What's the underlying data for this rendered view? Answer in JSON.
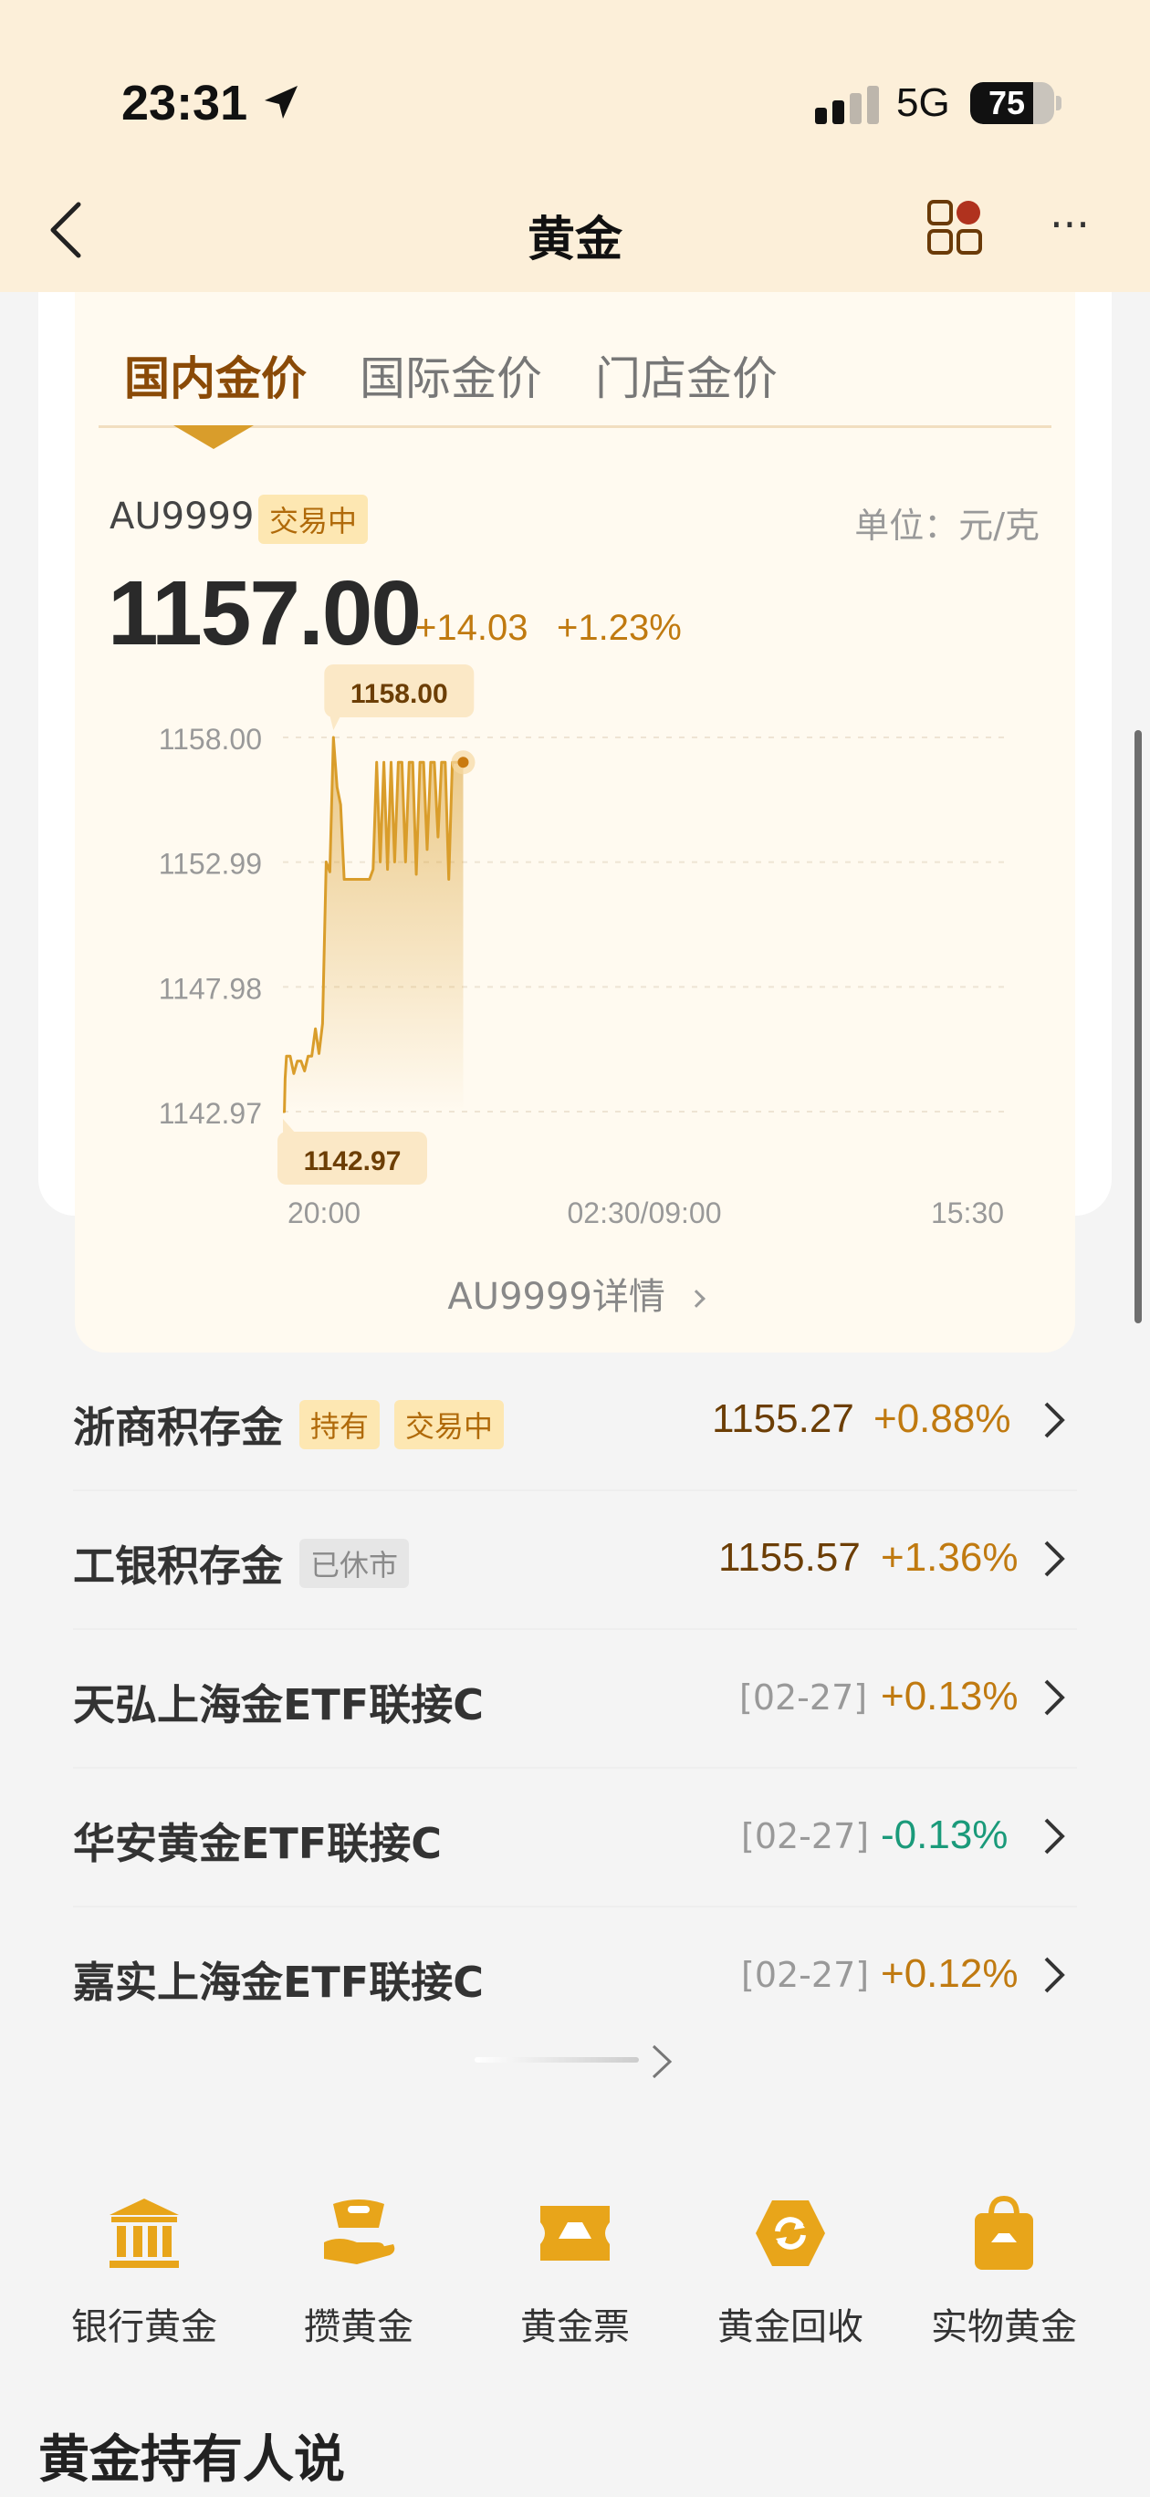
{
  "status_bar": {
    "time": "23:31",
    "network": "5G",
    "battery": "75"
  },
  "nav": {
    "title": "黄金"
  },
  "tabs": [
    {
      "label": "国内金价"
    },
    {
      "label": "国际金价"
    },
    {
      "label": "门店金价"
    }
  ],
  "quote": {
    "symbol": "AU9999",
    "status": "交易中",
    "unit": "单位：元/克",
    "price": "1157.00",
    "change": "+14.03",
    "change_pct": "+1.23%",
    "detail_link": "AU9999详情"
  },
  "chart_data": {
    "type": "line",
    "y_ticks": [
      "1158.00",
      "1152.99",
      "1147.98",
      "1142.97"
    ],
    "x_ticks": [
      "20:00",
      "02:30/09:00",
      "15:30"
    ],
    "ylim": [
      1142.97,
      1158.0
    ],
    "high_label": "1158.00",
    "low_label": "1142.97",
    "grid": true,
    "color": "#d99d2b",
    "x": [
      0,
      0.4,
      0.6,
      1,
      2,
      3,
      4,
      5,
      6,
      7,
      8,
      9,
      10,
      11,
      12,
      13,
      14,
      15,
      16,
      17,
      18,
      19,
      20,
      21,
      22,
      23,
      24,
      25,
      26,
      27,
      28,
      29,
      30,
      31,
      32,
      33,
      34,
      35,
      36,
      37,
      38,
      39,
      40,
      41,
      42,
      43,
      44,
      45,
      46,
      47,
      48,
      49,
      50
    ],
    "values": [
      1142.97,
      1142.97,
      1144.3,
      1145.2,
      1145.2,
      1144.5,
      1145.0,
      1145.0,
      1144.6,
      1145.2,
      1145.2,
      1146.3,
      1145.3,
      1146.5,
      1153.0,
      1152.6,
      1158.0,
      1156.0,
      1155.3,
      1152.3,
      1152.3,
      1152.3,
      1152.3,
      1152.3,
      1152.3,
      1152.3,
      1152.3,
      1152.7,
      1157.0,
      1153.0,
      1157.0,
      1152.7,
      1157.0,
      1153.0,
      1157.0,
      1157.0,
      1153.0,
      1157.0,
      1157.0,
      1152.5,
      1157.0,
      1157.0,
      1153.5,
      1157.0,
      1157.0,
      1154.0,
      1157.0,
      1157.0,
      1152.3,
      1157.0,
      1157.0,
      1157.0,
      1157.0
    ],
    "x_range": [
      0,
      200
    ]
  },
  "list": [
    {
      "name": "浙商积存金",
      "tags": [
        "持有",
        "交易中"
      ],
      "price": "1155.27",
      "change": "+0.88%"
    },
    {
      "name": "工银积存金",
      "tags": [
        "已休市"
      ],
      "price": "1155.57",
      "change": "+1.36%"
    },
    {
      "name": "天弘上海金ETF联接C",
      "date": "[02-27]",
      "change": "+0.13%"
    },
    {
      "name": "华安黄金ETF联接C",
      "date": "[02-27]",
      "change": "-0.13%"
    },
    {
      "name": "嘉实上海金ETF联接C",
      "date": "[02-27]",
      "change": "+0.12%"
    }
  ],
  "quick_links": [
    {
      "label": "银行黄金",
      "icon": "bank-icon"
    },
    {
      "label": "攒黄金",
      "icon": "gold-ingot-hand-icon"
    },
    {
      "label": "黄金票",
      "icon": "ticket-icon"
    },
    {
      "label": "黄金回收",
      "icon": "recycle-icon"
    },
    {
      "label": "实物黄金",
      "icon": "shopping-bag-icon"
    }
  ],
  "section": {
    "title": "黄金持有人说"
  },
  "colors": {
    "accent": "#d99d2b",
    "brown": "#8a4a07",
    "green": "#1a9a7a",
    "header_bg": "#fcefd9"
  }
}
